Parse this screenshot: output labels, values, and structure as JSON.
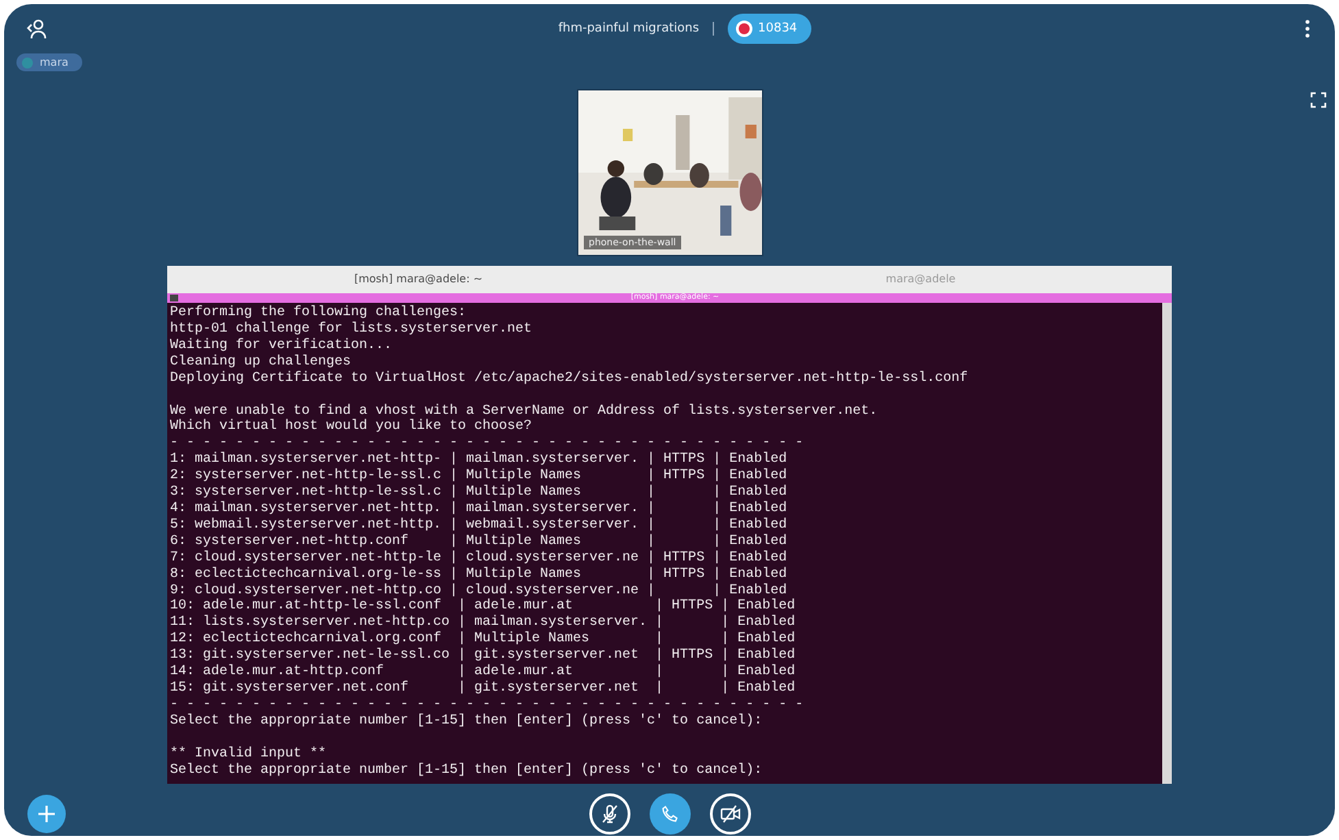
{
  "call": {
    "title": "fhm-painful migrations",
    "recording": {
      "on": true,
      "label": "10834"
    }
  },
  "participants": [
    {
      "name": "mara"
    }
  ],
  "video": {
    "kind": "picture",
    "caption": "phone-on-the-wall"
  },
  "terminal": {
    "tabs": [
      {
        "label": "[mosh] mara@adele: ~",
        "selected": true
      },
      {
        "label": "mara@adele",
        "selected": false
      }
    ],
    "bar_title": "[mosh] mara@adele: ~",
    "blocks": [
      [
        "Performing the following challenges:",
        "http-01 challenge for lists.systerserver.net",
        "Waiting for verification...",
        "Cleaning up challenges",
        "Deploying Certificate to VirtualHost /etc/apache2/sites-enabled/systerserver.net-http-le-ssl.conf"
      ],
      [
        "We were unable to find a vhost with a ServerName or Address of lists.systerserver.net.",
        "Which virtual host would you like to choose?",
        "- - - - - - - - - - - - - - - - - - - - - - - - - - - - - - - - - - - - - - -",
        "1: mailman.systerserver.net-http- | mailman.systerserver. | HTTPS | Enabled",
        "2: systerserver.net-http-le-ssl.c | Multiple Names        | HTTPS | Enabled",
        "3: systerserver.net-http-le-ssl.c | Multiple Names        |       | Enabled",
        "4: mailman.systerserver.net-http. | mailman.systerserver. |       | Enabled",
        "5: webmail.systerserver.net-http. | webmail.systerserver. |       | Enabled",
        "6: systerserver.net-http.conf     | Multiple Names        |       | Enabled",
        "7: cloud.systerserver.net-http-le | cloud.systerserver.ne | HTTPS | Enabled",
        "8: eclectictechcarnival.org-le-ss | Multiple Names        | HTTPS | Enabled",
        "9: cloud.systerserver.net-http.co | cloud.systerserver.ne |       | Enabled",
        "10: adele.mur.at-http-le-ssl.conf  | adele.mur.at          | HTTPS | Enabled",
        "11: lists.systerserver.net-http.co | mailman.systerserver. |       | Enabled",
        "12: eclectictechcarnival.org.conf  | Multiple Names        |       | Enabled",
        "13: git.systerserver.net-le-ssl.co | git.systerserver.net  | HTTPS | Enabled",
        "14: adele.mur.at-http.conf         | adele.mur.at          |       | Enabled",
        "15: git.systerserver.net.conf      | git.systerserver.net  |       | Enabled",
        "- - - - - - - - - - - - - - - - - - - - - - - - - - - - - - - - - - - - - - -",
        "Select the appropriate number [1-15] then [enter] (press 'c' to cancel):"
      ],
      [
        "** Invalid input **",
        "Select the appropriate number [1-15] then [enter] (press 'c' to cancel):"
      ]
    ]
  },
  "controls": {
    "mic_muted": true,
    "camera_off": true
  }
}
